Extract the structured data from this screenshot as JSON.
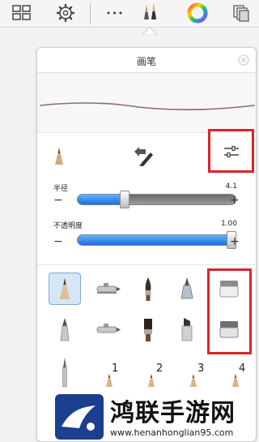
{
  "toolbar": {
    "icons": [
      "grid-icon",
      "gear-icon",
      "more-icon",
      "brush-library-icon",
      "color-wheel-icon",
      "layers-icon"
    ],
    "more_glyph": "•••"
  },
  "panel": {
    "title": "画笔",
    "close_glyph": "×",
    "radius": {
      "label": "半径",
      "value": "4.1",
      "level": 0.3
    },
    "opacity": {
      "label": "不透明度",
      "value": "1.00",
      "level": 1.0
    },
    "minus": "−",
    "plus": "+",
    "numbers": [
      "1",
      "2",
      "3",
      "4"
    ]
  },
  "colors": {
    "highlight": "#d9242b",
    "slider_fill": "#1f6fd6",
    "selected_bg": "#d6e6f6"
  },
  "watermark": {
    "text": "鸿联手游网",
    "url": "www.henanhonglian95.com"
  }
}
